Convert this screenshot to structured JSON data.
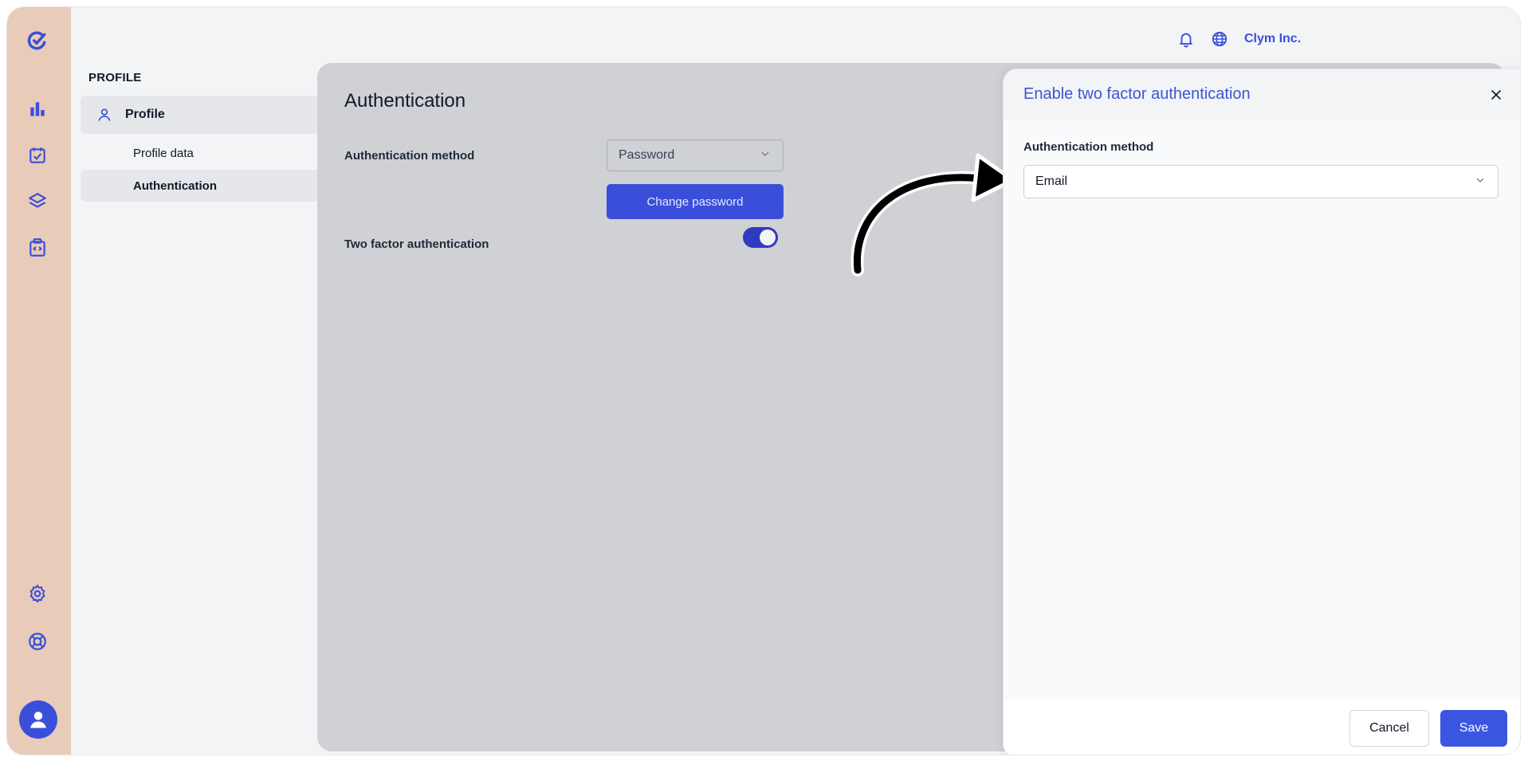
{
  "colors": {
    "accent": "#3a4fd9",
    "rail": "#e8cbb8",
    "overlay": "#cfd1d5",
    "toggle_on": "#2f3bbf"
  },
  "rail": {
    "icons": [
      "logo-icon",
      "bar-chart-icon",
      "checkbox-icon",
      "layers-icon",
      "code-clipboard-icon",
      "gear-icon",
      "lifebuoy-icon",
      "user-avatar-icon"
    ]
  },
  "header": {
    "org_name": "Clym Inc.",
    "icons": [
      "bell-icon",
      "globe-icon"
    ]
  },
  "subnav": {
    "title": "PROFILE",
    "parent_label": "Profile",
    "items": [
      {
        "label": "Profile data"
      },
      {
        "label": "Authentication"
      }
    ]
  },
  "content": {
    "title": "Authentication",
    "auth_method_label": "Authentication method",
    "auth_method_value": "Password",
    "change_password_label": "Change password",
    "two_factor_label": "Two factor authentication",
    "two_factor_enabled": true
  },
  "drawer": {
    "title": "Enable two factor authentication",
    "field_label": "Authentication method",
    "field_value": "Email",
    "cancel_label": "Cancel",
    "save_label": "Save"
  }
}
